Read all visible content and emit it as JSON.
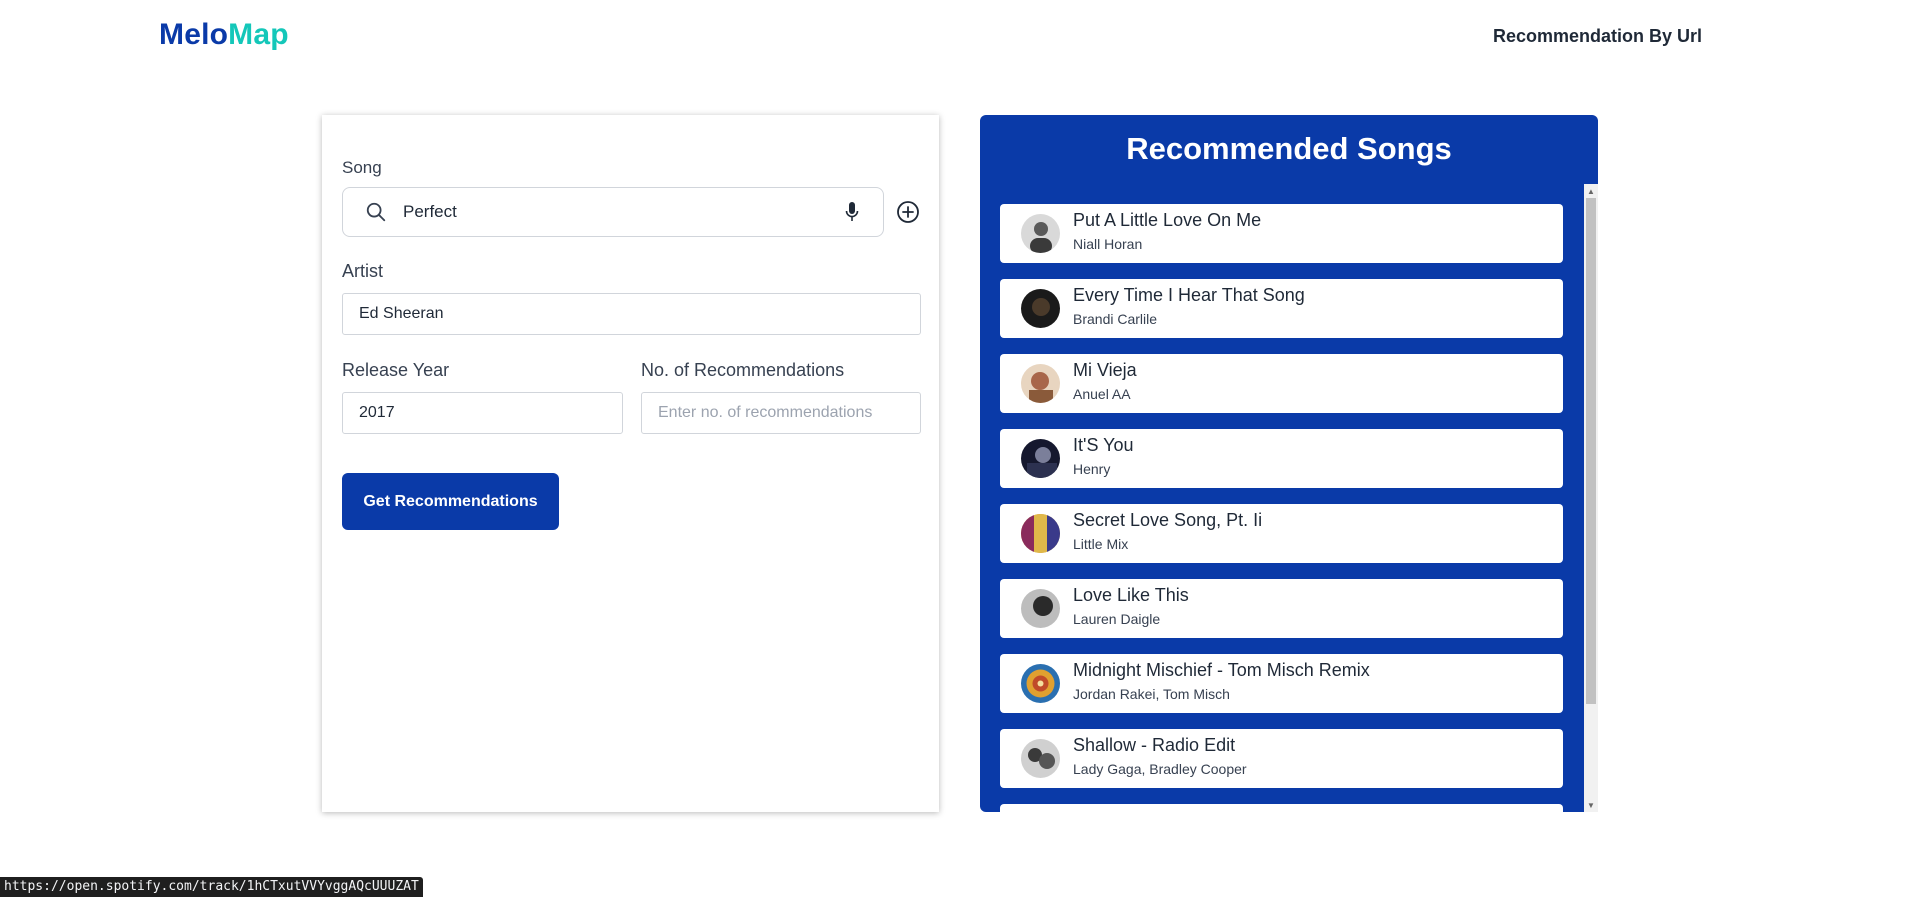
{
  "header": {
    "logo_part1": "Melo",
    "logo_part2": "Map",
    "nav_link": "Recommendation By Url"
  },
  "form": {
    "song_label": "Song",
    "song_value": "Perfect",
    "artist_label": "Artist",
    "artist_value": "Ed Sheeran",
    "year_label": "Release Year",
    "year_value": "2017",
    "count_label": "No. of Recommendations",
    "count_placeholder": "Enter no. of recommendations",
    "submit_label": "Get Recommendations"
  },
  "results": {
    "title": "Recommended Songs",
    "songs": [
      {
        "title": "Put A Little Love On Me",
        "artist": "Niall Horan"
      },
      {
        "title": "Every Time I Hear That Song",
        "artist": "Brandi Carlile"
      },
      {
        "title": "Mi Vieja",
        "artist": "Anuel AA"
      },
      {
        "title": "It'S You",
        "artist": "Henry"
      },
      {
        "title": "Secret Love Song, Pt. Ii",
        "artist": "Little Mix"
      },
      {
        "title": "Love Like This",
        "artist": "Lauren Daigle"
      },
      {
        "title": "Midnight Mischief - Tom Misch Remix",
        "artist": "Jordan Rakei, Tom Misch"
      },
      {
        "title": "Shallow - Radio Edit",
        "artist": "Lady Gaga, Bradley Cooper"
      }
    ]
  },
  "status_bar": {
    "url": "https://open.spotify.com/track/1hCTxutVVYvggAQcUUUZAT"
  },
  "colors": {
    "primary": "#0a3aa8",
    "accent": "#14c7b9"
  }
}
